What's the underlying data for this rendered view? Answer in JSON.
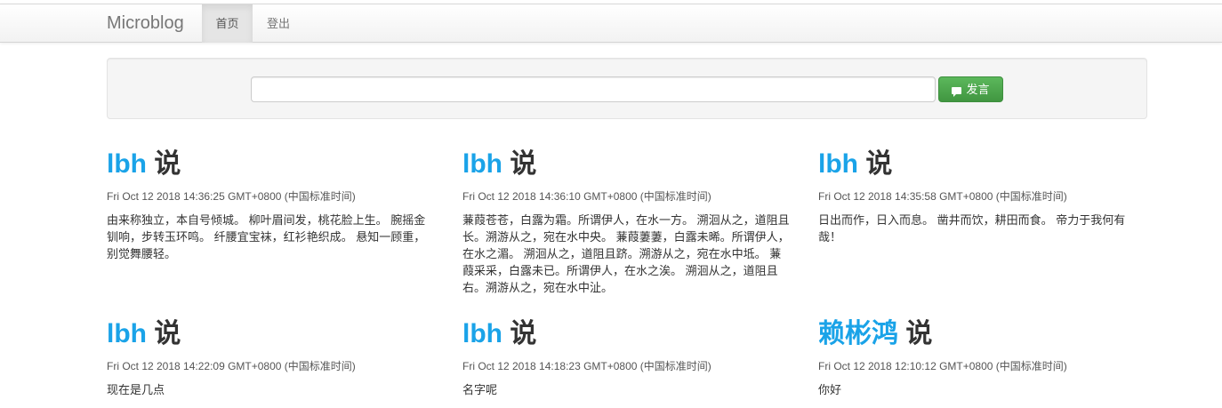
{
  "navbar": {
    "brand": "Microblog",
    "items": [
      {
        "label": "首页",
        "active": true
      },
      {
        "label": "登出",
        "active": false
      }
    ]
  },
  "compose": {
    "input_value": "",
    "input_placeholder": "",
    "button_label": "发言",
    "button_icon": "comment-icon",
    "button_color": "#5cb85c"
  },
  "posts": [
    {
      "author": "lbh",
      "says": "说",
      "time": "Fri Oct 12 2018 14:36:25 GMT+0800 (中国标准时间)",
      "content": "由来称独立，本自号倾城。 柳叶眉间发，桃花脸上生。 腕摇金钏响，步转玉环鸣。 纤腰宜宝袜，红衫艳织成。 悬知一顾重，别觉舞腰轻。"
    },
    {
      "author": "lbh",
      "says": "说",
      "time": "Fri Oct 12 2018 14:36:10 GMT+0800 (中国标准时间)",
      "content": "蒹葭苍苍，白露为霜。所谓伊人，在水一方。 溯洄从之，道阻且长。溯游从之，宛在水中央。 蒹葭萋萋，白露未晞。所谓伊人，在水之湄。 溯洄从之，道阻且跻。溯游从之，宛在水中坻。 蒹葭采采，白露未已。所谓伊人，在水之涘。 溯洄从之，道阻且右。溯游从之，宛在水中沚。"
    },
    {
      "author": "lbh",
      "says": "说",
      "time": "Fri Oct 12 2018 14:35:58 GMT+0800 (中国标准时间)",
      "content": "日出而作，日入而息。 凿井而饮，耕田而食。 帝力于我何有哉！"
    },
    {
      "author": "lbh",
      "says": "说",
      "time": "Fri Oct 12 2018 14:22:09 GMT+0800 (中国标准时间)",
      "content": "现在是几点"
    },
    {
      "author": "lbh",
      "says": "说",
      "time": "Fri Oct 12 2018 14:18:23 GMT+0800 (中国标准时间)",
      "content": "名字呢"
    },
    {
      "author": "赖彬鸿",
      "says": "说",
      "time": "Fri Oct 12 2018 12:10:12 GMT+0800 (中国标准时间)",
      "content": "你好"
    }
  ],
  "colors": {
    "author_link": "#1aa3e8",
    "text": "#333333"
  }
}
